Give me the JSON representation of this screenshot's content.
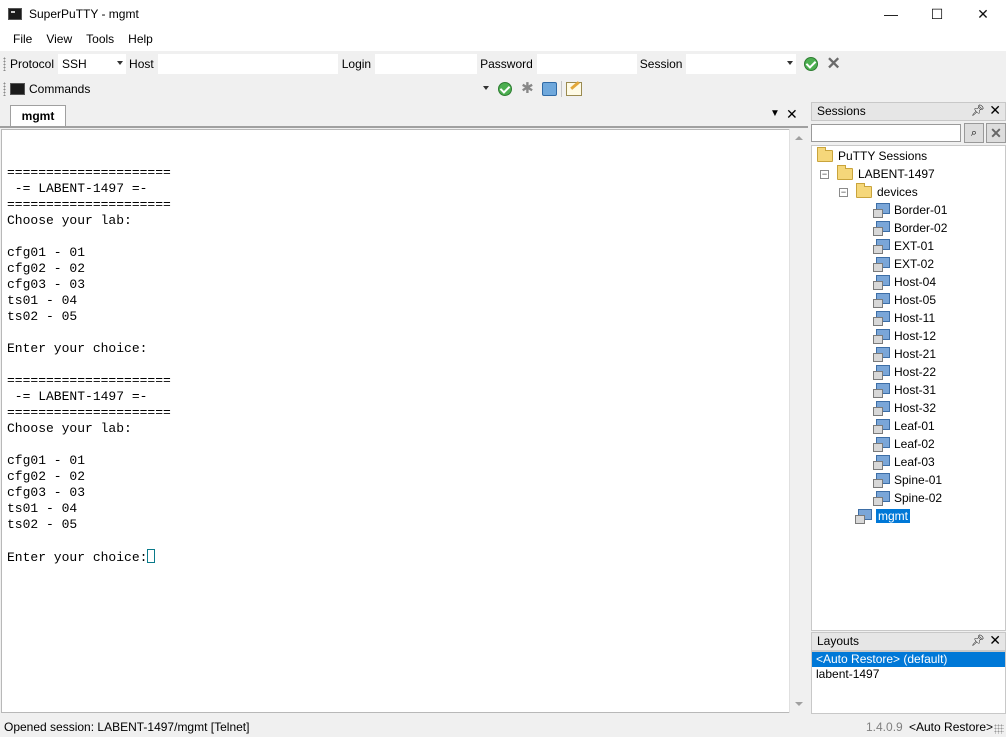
{
  "window": {
    "title": "SuperPuTTY - mgmt",
    "controls": [
      "—",
      "☐",
      "✕"
    ]
  },
  "menu": [
    "File",
    "View",
    "Tools",
    "Help"
  ],
  "toolbar": {
    "protocol_label": "Protocol",
    "protocol_value": "SSH",
    "host_label": "Host",
    "host_value": "",
    "login_label": "Login",
    "login_value": "",
    "password_label": "Password",
    "password_value": "",
    "session_label": "Session",
    "session_value": ""
  },
  "commands": {
    "label": "Commands",
    "value": ""
  },
  "document": {
    "tab_label": "mgmt",
    "terminal_lines": [
      "=====================",
      " -= LABENT-1497 =-",
      "=====================",
      "Choose your lab:",
      "",
      "cfg01 - 01",
      "cfg02 - 02",
      "cfg03 - 03",
      "ts01 - 04",
      "ts02 - 05",
      "",
      "Enter your choice:",
      "",
      "=====================",
      " -= LABENT-1497 =-",
      "=====================",
      "Choose your lab:",
      "",
      "cfg01 - 01",
      "cfg02 - 02",
      "cfg03 - 03",
      "ts01 - 04",
      "ts02 - 05",
      "",
      "Enter your choice:"
    ]
  },
  "sessions_panel": {
    "title": "Sessions",
    "root": "PuTTY Sessions",
    "group": "LABENT-1497",
    "subfolder": "devices",
    "devices": [
      "Border-01",
      "Border-02",
      "EXT-01",
      "EXT-02",
      "Host-04",
      "Host-05",
      "Host-11",
      "Host-12",
      "Host-21",
      "Host-22",
      "Host-31",
      "Host-32",
      "Leaf-01",
      "Leaf-02",
      "Leaf-03",
      "Spine-01",
      "Spine-02"
    ],
    "selected_session": "mgmt"
  },
  "layouts_panel": {
    "title": "Layouts",
    "items": [
      "<Auto Restore> (default)",
      "labent-1497"
    ]
  },
  "status": {
    "message": "Opened session: LABENT-1497/mgmt [Telnet]",
    "version": "1.4.0.9",
    "layout": "<Auto Restore>"
  },
  "colors": {
    "selection": "#0078d7",
    "background": "#f0f0f0"
  }
}
